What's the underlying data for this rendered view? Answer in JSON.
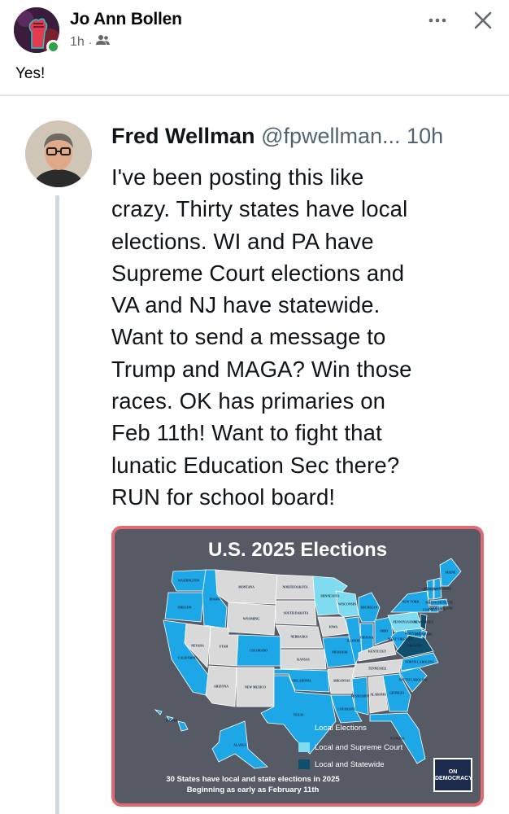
{
  "post": {
    "author": "Jo Ann Bollen",
    "time": "1h",
    "audience_icon": "friends-icon",
    "text": "Yes!",
    "more_icon": "more-icon",
    "close_icon": "close-icon"
  },
  "tweet": {
    "name": "Fred Wellman",
    "handle": "@fpwellman...",
    "time": "10h",
    "body": "I've been posting this like\ncrazy. Thirty states have local\nelections. WI and PA have\nSupreme Court elections and\nVA and NJ have statewide.\nWant to send a message to\nTrump and MAGA? Win those\nraces. OK has primaries on\nFeb 11th! Want to fight that\nlunatic Education Sec there?\nRUN for school board!"
  },
  "map": {
    "title": "U.S. 2025 Elections",
    "legend": [
      {
        "label": "Local Elections",
        "color": "#1ea7e6"
      },
      {
        "label": "Local and Supreme Court",
        "color": "#7fdcf0"
      },
      {
        "label": "Local and Statewide",
        "color": "#0d4f6c"
      }
    ],
    "footer_line1": "30 States have local and state elections in 2025",
    "footer_line2": "Beginning as early as February 11th",
    "logo_text_1": "ON",
    "logo_text_2": "DEMOCRACY",
    "colors": {
      "local": "#1ea7e6",
      "none": "#d9d9d9",
      "supreme": "#7fdcf0",
      "statewide": "#0d4f6c",
      "background": "#555a64",
      "border": "#e06a72"
    },
    "state_labels": {
      "wa": "WASHINGTON",
      "or": "OREGON",
      "ca": "CALIFORNIA",
      "nv": "NEVADA",
      "id": "IDAHO",
      "mt": "MONTANA",
      "wy": "WYOMING",
      "ut": "UTAH",
      "az": "ARIZONA",
      "co": "COLORADO",
      "nm": "NEW MEXICO",
      "nd": "NORTH DAKOTA",
      "sd": "SOUTH DAKOTA",
      "ne": "NEBRASKA",
      "ks": "KANSAS",
      "ok": "OKLAHOMA",
      "tx": "TEXAS",
      "mn": "MINNESOTA",
      "ia": "IOWA",
      "mo": "MISSOURI",
      "ar": "ARKANSAS",
      "la": "LOUISIANA",
      "wi": "WISCONSIN",
      "il": "ILLINOIS",
      "mi": "MICHIGAN",
      "in": "INDIANA",
      "oh": "OHIO",
      "ky": "KENTUCKY",
      "tn": "TENNESSEE",
      "ms": "MISSISSIPPI",
      "al": "ALABAMA",
      "ga": "GEORGIA",
      "fl": "FLORIDA",
      "sc": "SOUTH CAROLINA",
      "nc": "NORTH CAROLINA",
      "va": "VIRGINIA",
      "wv": "WEST VIRGINIA",
      "pa": "PENNSYLVANIA",
      "ny": "NEW YORK",
      "vt": "VERMONT",
      "nh": "NEW HAMPSHIRE",
      "me": "MAINE",
      "ma": "MASSACHUSETTS",
      "ri": "RHODE ISLAND",
      "ct": "CONNECTICUT",
      "nj": "NEW JERSEY",
      "de": "DELAWARE",
      "md": "MARYLAND",
      "ak": "ALASKA",
      "hi": "HAWAII"
    }
  }
}
